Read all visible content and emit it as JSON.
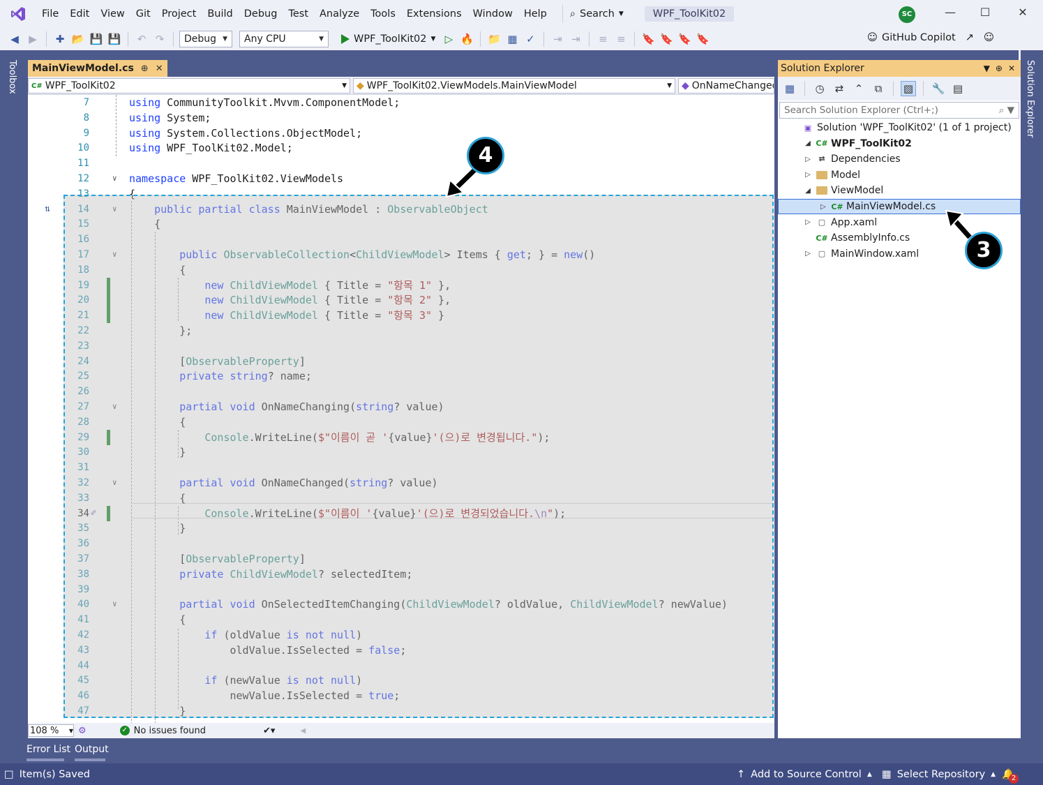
{
  "menubar": {
    "items": [
      "File",
      "Edit",
      "View",
      "Git",
      "Project",
      "Build",
      "Debug",
      "Test",
      "Analyze",
      "Tools",
      "Extensions",
      "Window",
      "Help"
    ],
    "search_label": "Search",
    "solution_title": "WPF_ToolKit02",
    "avatar_initials": "SC"
  },
  "toolbar": {
    "config": "Debug",
    "platform": "Any CPU",
    "run_target": "WPF_ToolKit02",
    "copilot_label": "GitHub Copilot"
  },
  "side": {
    "toolbox_label": "Toolbox",
    "solution_explorer_label": "Solution Explorer"
  },
  "editor": {
    "tab_label": "MainViewModel.cs",
    "nav_project": "WPF_ToolKit02",
    "nav_class": "WPF_ToolKit02.ViewModels.MainViewModel",
    "nav_member": "OnNameChanged",
    "zoom": "108 %",
    "issues": "No issues found",
    "lines": [
      {
        "n": "7",
        "t": "using CommunityToolkit.Mvvm.ComponentModel;"
      },
      {
        "n": "8",
        "t": "using System;"
      },
      {
        "n": "9",
        "t": "using System.Collections.ObjectModel;"
      },
      {
        "n": "10",
        "t": "using WPF_ToolKit02.Model;"
      },
      {
        "n": "11",
        "t": ""
      },
      {
        "n": "12",
        "t": "namespace WPF_ToolKit02.ViewModels"
      },
      {
        "n": "13",
        "t": "{"
      },
      {
        "n": "14",
        "t": "    public partial class MainViewModel : ObservableObject"
      },
      {
        "n": "15",
        "t": "    {"
      },
      {
        "n": "16",
        "t": ""
      },
      {
        "n": "17",
        "t": "        public ObservableCollection<ChildViewModel> Items { get; } = new()"
      },
      {
        "n": "18",
        "t": "        {"
      },
      {
        "n": "19",
        "t": "            new ChildViewModel { Title = \"항목 1\" },"
      },
      {
        "n": "20",
        "t": "            new ChildViewModel { Title = \"항목 2\" },"
      },
      {
        "n": "21",
        "t": "            new ChildViewModel { Title = \"항목 3\" }"
      },
      {
        "n": "22",
        "t": "        };"
      },
      {
        "n": "23",
        "t": ""
      },
      {
        "n": "24",
        "t": "        [ObservableProperty]"
      },
      {
        "n": "25",
        "t": "        private string? name;"
      },
      {
        "n": "26",
        "t": ""
      },
      {
        "n": "27",
        "t": "        partial void OnNameChanging(string? value)"
      },
      {
        "n": "28",
        "t": "        {"
      },
      {
        "n": "29",
        "t": "            Console.WriteLine($\"이름이 곧 '{value}'(으)로 변경됩니다.\");"
      },
      {
        "n": "30",
        "t": "        }"
      },
      {
        "n": "31",
        "t": ""
      },
      {
        "n": "32",
        "t": "        partial void OnNameChanged(string? value)"
      },
      {
        "n": "33",
        "t": "        {"
      },
      {
        "n": "34",
        "t": "            Console.WriteLine($\"이름이 '{value}'(으)로 변경되었습니다.\\n\");"
      },
      {
        "n": "35",
        "t": "        }"
      },
      {
        "n": "36",
        "t": ""
      },
      {
        "n": "37",
        "t": "        [ObservableProperty]"
      },
      {
        "n": "38",
        "t": "        private ChildViewModel? selectedItem;"
      },
      {
        "n": "39",
        "t": ""
      },
      {
        "n": "40",
        "t": "        partial void OnSelectedItemChanging(ChildViewModel? oldValue, ChildViewModel? newValue)"
      },
      {
        "n": "41",
        "t": "        {"
      },
      {
        "n": "42",
        "t": "            if (oldValue is not null)"
      },
      {
        "n": "43",
        "t": "                oldValue.IsSelected = false;"
      },
      {
        "n": "44",
        "t": ""
      },
      {
        "n": "45",
        "t": "            if (newValue is not null)"
      },
      {
        "n": "46",
        "t": "                newValue.IsSelected = true;"
      },
      {
        "n": "47",
        "t": "        }"
      }
    ]
  },
  "solution_explorer": {
    "title": "Solution Explorer",
    "search_placeholder": "Search Solution Explorer (Ctrl+;)",
    "items": [
      {
        "label": "Solution 'WPF_ToolKit02' (1 of 1 project)",
        "icon": "solution-icon"
      },
      {
        "label": "WPF_ToolKit02",
        "icon": "csharp-project-icon"
      },
      {
        "label": "Dependencies",
        "icon": "dependencies-icon"
      },
      {
        "label": "Model",
        "icon": "folder-icon"
      },
      {
        "label": "ViewModel",
        "icon": "folder-icon"
      },
      {
        "label": "MainViewModel.cs",
        "icon": "csharp-file-icon"
      },
      {
        "label": "App.xaml",
        "icon": "xaml-file-icon"
      },
      {
        "label": "AssemblyInfo.cs",
        "icon": "csharp-file-icon"
      },
      {
        "label": "MainWindow.xaml",
        "icon": "xaml-file-icon"
      }
    ]
  },
  "bottom_tabs": [
    "Error List",
    "Output"
  ],
  "statusbar": {
    "left": "Item(s) Saved",
    "source_control": "Add to Source Control",
    "repository": "Select Repository",
    "notifications": "2"
  },
  "callouts": [
    "4",
    "3"
  ],
  "colors": {
    "keyword": "#1f3fff",
    "type": "#2b8a7e",
    "string": "#a31515",
    "frame": "#4d5a8c",
    "active_tab": "#f5cc84",
    "highlight_border": "#21a4d8"
  }
}
